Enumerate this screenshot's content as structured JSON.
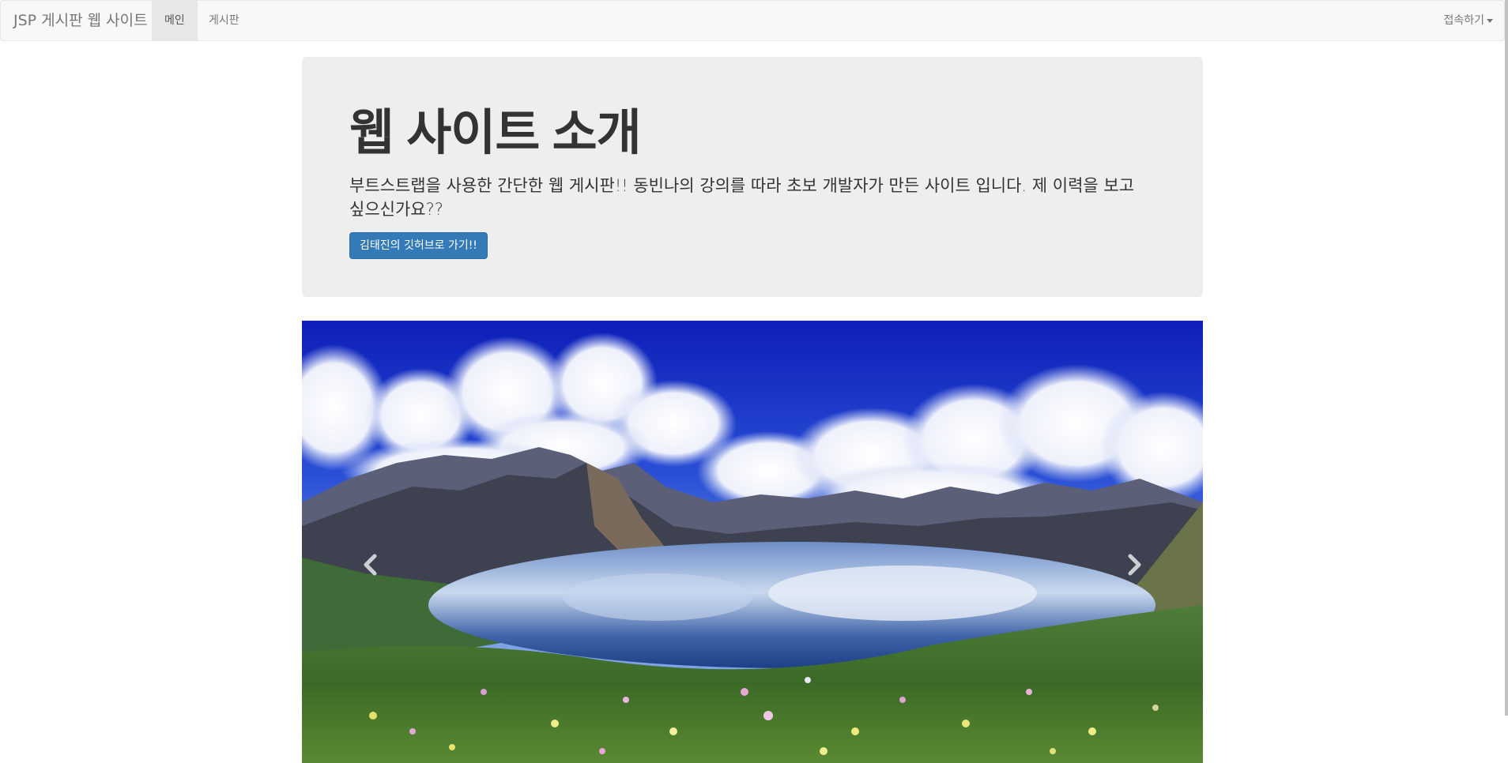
{
  "navbar": {
    "brand": "JSP 게시판 웹 사이트",
    "items": [
      {
        "label": "메인",
        "active": true
      },
      {
        "label": "게시판",
        "active": false
      }
    ],
    "dropdown_label": "접속하기"
  },
  "jumbotron": {
    "title": "웹 사이트 소개",
    "description": "부트스트랩을 사용한 간단한 웹 게시판!! 동빈나의 강의를 따라 초보 개발자가 만든 사이트 입니다. 제 이력을 보고 싶으신가요??",
    "button_label": "김태진의 깃허브로 가기!!"
  },
  "carousel": {
    "image_alt": "mountain-lake-landscape",
    "controls": [
      "chevron-left-icon",
      "chevron-right-icon"
    ]
  },
  "colors": {
    "navbar_bg": "#f8f8f8",
    "jumbotron_bg": "#eeeeee",
    "primary_button": "#337ab7"
  }
}
